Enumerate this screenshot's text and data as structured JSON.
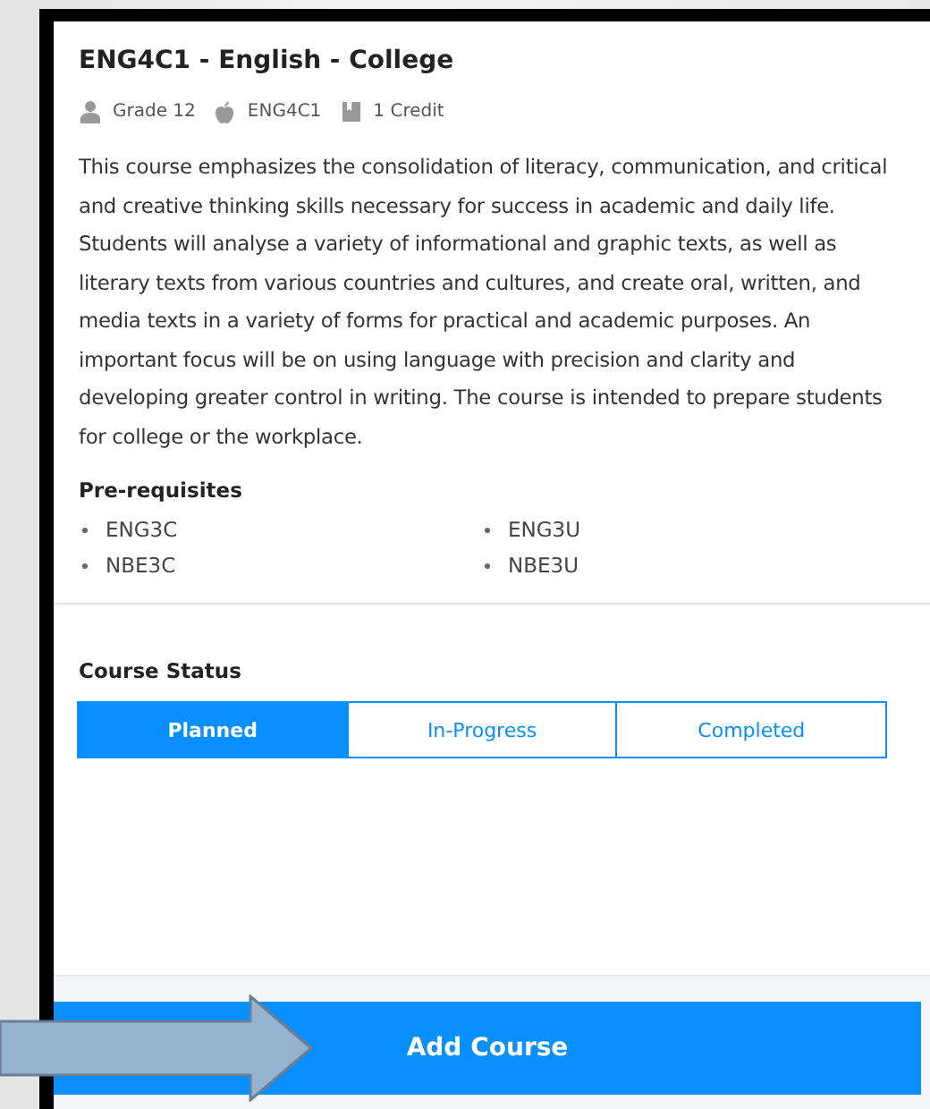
{
  "course": {
    "title": "ENG4C1 - English - College",
    "meta": [
      {
        "kind": "person",
        "text": "Grade 12"
      },
      {
        "kind": "apple",
        "text": "ENG4C1"
      },
      {
        "kind": "book",
        "text": "1 Credit"
      }
    ],
    "description": "This course emphasizes the consolidation of literacy, communication, and critical and creative thinking skills necessary for success in academic and daily life. Students will analyse a variety of informational and graphic texts, as well as literary texts from various countries and cultures, and create oral, written, and media texts in a variety of forms for practical and academic purposes. An important focus will be on using language with precision and clarity and developing greater control in writing. The course is intended to prepare students for college or the workplace.",
    "prerequisites": {
      "heading": "Pre-requisites",
      "items": [
        "ENG3C",
        "ENG3U",
        "NBE3C",
        "NBE3U"
      ]
    }
  },
  "status": {
    "heading": "Course Status",
    "options": [
      {
        "label": "Planned",
        "selected": true
      },
      {
        "label": "In-Progress",
        "selected": false
      },
      {
        "label": "Completed",
        "selected": false
      }
    ]
  },
  "add_button": {
    "label": "Add Course"
  }
}
